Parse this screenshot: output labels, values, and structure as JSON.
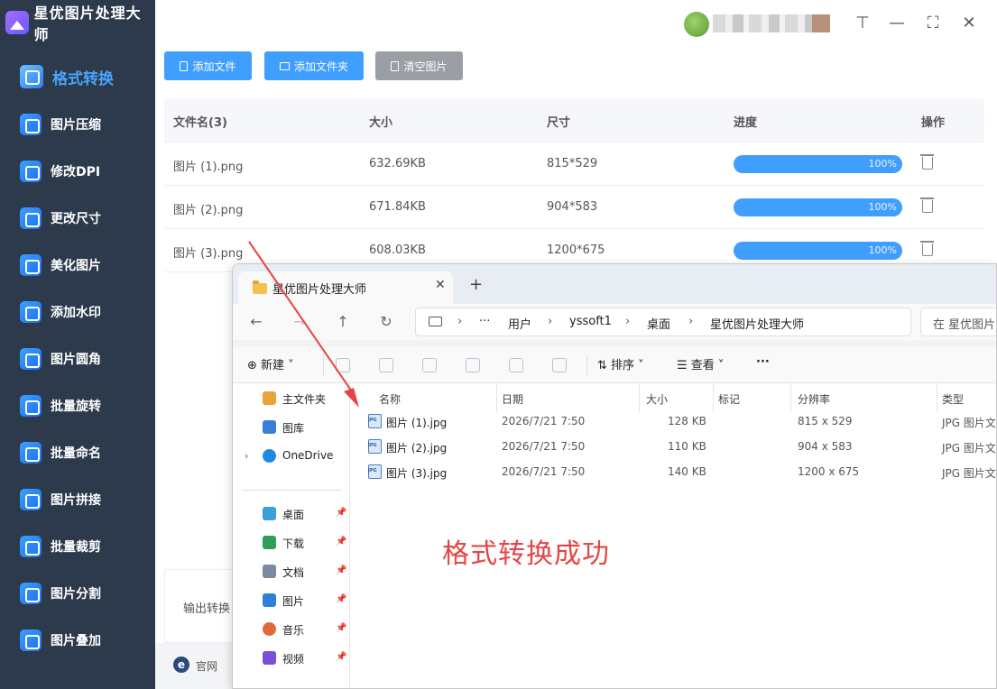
{
  "app": {
    "title": "星优图片处理大师",
    "nav": [
      {
        "label": "格式转换",
        "active": true
      },
      {
        "label": "图片压缩"
      },
      {
        "label": "修改DPI"
      },
      {
        "label": "更改尺寸"
      },
      {
        "label": "美化图片"
      },
      {
        "label": "添加水印"
      },
      {
        "label": "图片圆角"
      },
      {
        "label": "批量旋转"
      },
      {
        "label": "批量命名"
      },
      {
        "label": "图片拼接"
      },
      {
        "label": "批量裁剪"
      },
      {
        "label": "图片分割"
      },
      {
        "label": "图片叠加"
      }
    ],
    "window": {
      "pin": "⊤",
      "minimize": "—",
      "maximize": "⛶",
      "close": "✕"
    },
    "toolbar": {
      "add_file": "添加文件",
      "add_folder": "添加文件夹",
      "clear": "清空图片"
    },
    "table": {
      "headers": {
        "name": "文件名(3)",
        "size": "大小",
        "dims": "尺寸",
        "progress": "进度",
        "action": "操作"
      },
      "rows": [
        {
          "name": "图片 (1).png",
          "size": "632.69KB",
          "dims": "815*529",
          "progress": "100%"
        },
        {
          "name": "图片 (2).png",
          "size": "671.84KB",
          "dims": "904*583",
          "progress": "100%"
        },
        {
          "name": "图片 (3).png",
          "size": "608.03KB",
          "dims": "1200*675",
          "progress": "100%"
        }
      ]
    },
    "output_label": "输出转换",
    "footer": {
      "icon": "e",
      "site": "官网"
    }
  },
  "explorer": {
    "tab_title": "星优图片处理大师",
    "tab_close": "✕",
    "new_tab": "+",
    "nav": {
      "back": "←",
      "forward": "→",
      "up": "↑",
      "refresh": "↻"
    },
    "address": {
      "sep": "›",
      "more": "···",
      "parts": [
        "用户",
        "yssoft1",
        "桌面",
        "星优图片处理大师"
      ]
    },
    "search_placeholder": "在 星优图片",
    "commands": {
      "new": "⊕ 新建 ˅",
      "sort": "⇅ 排序 ˅",
      "view": "☰ 查看 ˅",
      "more": "···"
    },
    "sidebar": [
      {
        "label": "主文件夹",
        "color": "#e8a33d"
      },
      {
        "label": "图库",
        "color": "#3b7dd8"
      },
      {
        "label": "OneDrive",
        "color": "#1e88e5",
        "chevron": "›"
      },
      {
        "label": "桌面",
        "color": "#3aa0d8",
        "pin": "📌"
      },
      {
        "label": "下载",
        "color": "#2e9e5b",
        "pin": "📌"
      },
      {
        "label": "文档",
        "color": "#7a8aa0",
        "pin": "📌"
      },
      {
        "label": "图片",
        "color": "#2f80d8",
        "pin": "📌"
      },
      {
        "label": "音乐",
        "color": "#e0683c",
        "pin": "📌"
      },
      {
        "label": "视频",
        "color": "#7b4fd6",
        "pin": "📌"
      }
    ],
    "columns": {
      "name": "名称",
      "date": "日期",
      "size": "大小",
      "tag": "标记",
      "res": "分辨率",
      "type": "类型"
    },
    "files": [
      {
        "name": "图片 (1).jpg",
        "date": "2026/7/21 7:50",
        "size": "128 KB",
        "res": "815 x 529",
        "type": "JPG 图片文"
      },
      {
        "name": "图片 (2).jpg",
        "date": "2026/7/21 7:50",
        "size": "110 KB",
        "res": "904 x 583",
        "type": "JPG 图片文"
      },
      {
        "name": "图片 (3).jpg",
        "date": "2026/7/21 7:50",
        "size": "140 KB",
        "res": "1200 x 675",
        "type": "JPG 图片文"
      }
    ]
  },
  "annotation": {
    "success_text": "格式转换成功",
    "arrow_color": "#e64545"
  }
}
